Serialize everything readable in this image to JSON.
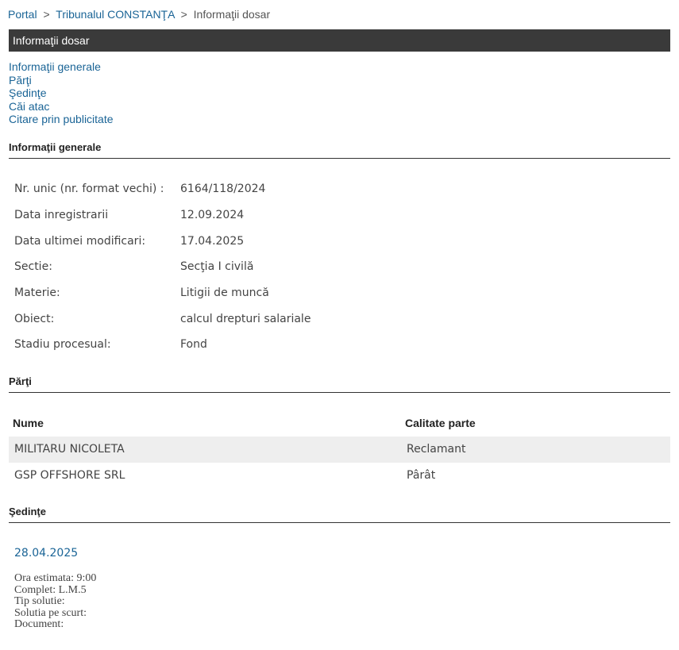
{
  "breadcrumb": {
    "items": [
      "Portal",
      "Tribunalul CONSTANŢA"
    ],
    "separator": ">",
    "current": "Informaţii dosar"
  },
  "title_bar": {
    "title": "Informaţii dosar"
  },
  "anchor_nav": {
    "items": [
      "Informaţii generale",
      "Părţi",
      "Şedinţe",
      "Căi atac",
      "Citare prin publicitate"
    ]
  },
  "general_info": {
    "heading": "Informaţii generale",
    "rows": [
      {
        "label": "Nr. unic (nr. format vechi) :",
        "value": "6164/118/2024"
      },
      {
        "label": "Data inregistrarii",
        "value": "12.09.2024"
      },
      {
        "label": "Data ultimei modificari:",
        "value": "17.04.2025"
      },
      {
        "label": "Sectie:",
        "value": "Secţia I civilă"
      },
      {
        "label": "Materie:",
        "value": "Litigii de muncă"
      },
      {
        "label": "Obiect:",
        "value": "calcul drepturi salariale"
      },
      {
        "label": "Stadiu procesual:",
        "value": "Fond"
      }
    ]
  },
  "parties": {
    "heading": "Părţi",
    "columns": [
      "Nume",
      "Calitate parte"
    ],
    "rows": [
      {
        "name": "MILITARU NICOLETA",
        "role": "Reclamant"
      },
      {
        "name": "GSP OFFSHORE SRL",
        "role": "Pârât"
      }
    ]
  },
  "hearings": {
    "heading": "Şedinţe",
    "items": [
      {
        "date": "28.04.2025",
        "details": [
          "Ora estimata: 9:00",
          "Complet: L.M.5",
          "Tip solutie:",
          "Solutia pe scurt:",
          "Document:"
        ]
      }
    ]
  },
  "colors": {
    "link": "#1a6496",
    "title_bar_bg": "#3a3a3a",
    "alt_row_bg": "#eeeeee"
  }
}
